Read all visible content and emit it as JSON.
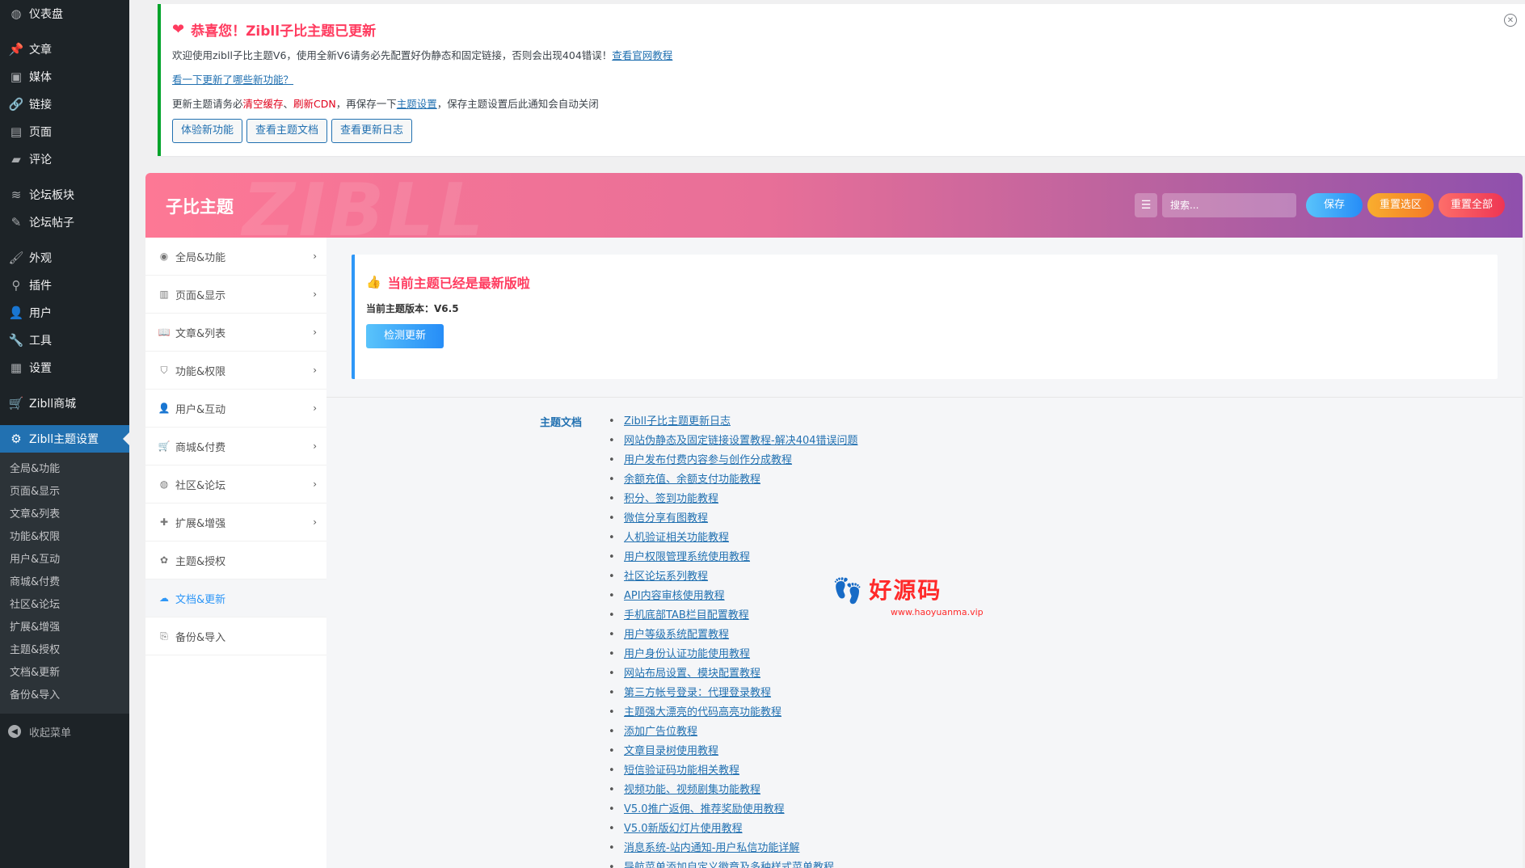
{
  "adminmenu": {
    "groups": [
      [
        {
          "label": "仪表盘",
          "icon": "dashboard-icon"
        }
      ],
      [
        {
          "label": "文章",
          "icon": "pin-icon"
        },
        {
          "label": "媒体",
          "icon": "media-icon"
        },
        {
          "label": "链接",
          "icon": "link-icon"
        },
        {
          "label": "页面",
          "icon": "page-icon"
        },
        {
          "label": "评论",
          "icon": "comment-icon"
        }
      ],
      [
        {
          "label": "论坛板块",
          "icon": "forum-icon"
        },
        {
          "label": "论坛帖子",
          "icon": "forum-post-icon"
        }
      ],
      [
        {
          "label": "外观",
          "icon": "brush-icon"
        },
        {
          "label": "插件",
          "icon": "plugin-icon"
        },
        {
          "label": "用户",
          "icon": "user-icon"
        },
        {
          "label": "工具",
          "icon": "wrench-icon"
        },
        {
          "label": "设置",
          "icon": "settings-icon"
        }
      ],
      [
        {
          "label": "Zibll商城",
          "icon": "cart-icon"
        }
      ]
    ],
    "active": {
      "label": "Zibll主题设置",
      "icon": "gear-icon"
    },
    "submenu": [
      "全局&功能",
      "页面&显示",
      "文章&列表",
      "功能&权限",
      "用户&互动",
      "商城&付费",
      "社区&论坛",
      "扩展&增强",
      "主题&授权",
      "文档&更新",
      "备份&导入"
    ],
    "collapse": "收起菜单"
  },
  "notice": {
    "title": "恭喜您！Zibll子比主题已更新",
    "line1_text": "欢迎使用zibll子比主题V6，使用全新V6请务必先配置好伪静态和固定链接，否则会出现404错误！",
    "line1_link": "查看官网教程",
    "line2_link": "看一下更新了哪些新功能？",
    "line3_a": "更新主题请务必",
    "line3_b": "清空缓存",
    "line3_c": "、",
    "line3_d": "刷新CDN",
    "line3_e": "，再保存一下",
    "line3_f": "主题设置",
    "line3_g": "，保存主题设置后此通知会自动关闭",
    "buttons": [
      "体验新功能",
      "查看主题文档",
      "查看更新日志"
    ]
  },
  "panel": {
    "title": "子比主题",
    "watermark": "ZIBLL",
    "search_placeholder": "搜索...",
    "save": "保存",
    "reset_section": "重置选区",
    "reset_all": "重置全部",
    "nav": [
      {
        "label": "全局&功能",
        "icon": "circle-dot-icon",
        "chevron": true
      },
      {
        "label": "页面&显示",
        "icon": "calendar-icon",
        "chevron": true
      },
      {
        "label": "文章&列表",
        "icon": "book-icon",
        "chevron": true
      },
      {
        "label": "功能&权限",
        "icon": "shield-icon",
        "chevron": true
      },
      {
        "label": "用户&互动",
        "icon": "user-icon",
        "chevron": true
      },
      {
        "label": "商城&付费",
        "icon": "cart-icon",
        "chevron": true
      },
      {
        "label": "社区&论坛",
        "icon": "compass-icon",
        "chevron": true
      },
      {
        "label": "扩展&增强",
        "icon": "puzzle-icon",
        "chevron": true
      },
      {
        "label": "主题&授权",
        "icon": "theme-icon",
        "chevron": false
      },
      {
        "label": "文档&更新",
        "icon": "cloud-icon",
        "chevron": false,
        "active": true
      },
      {
        "label": "备份&导入",
        "icon": "backup-icon",
        "chevron": false
      }
    ],
    "card": {
      "title": "当前主题已经是最新版啦",
      "version": "当前主题版本：V6.5",
      "check_button": "检测更新"
    },
    "docs_label": "主题文档",
    "docs": [
      "Zibll子比主题更新日志",
      "网站伪静态及固定链接设置教程-解决404错误问题",
      "用户发布付费内容参与创作分成教程",
      "余额充值、余额支付功能教程",
      "积分、签到功能教程",
      "微信分享有图教程",
      "人机验证相关功能教程",
      "用户权限管理系统使用教程",
      "社区论坛系列教程",
      "API内容审核使用教程",
      "手机底部TAB栏目配置教程",
      "用户等级系统配置教程",
      "用户身份认证功能使用教程",
      "网站布局设置、模块配置教程",
      "第三方帐号登录：代理登录教程",
      "主题强大漂亮的代码高亮功能教程",
      "添加广告位教程",
      "文章目录树使用教程",
      "短信验证码功能相关教程",
      "视频功能、视频剧集功能教程",
      "V5.0推广返佣、推荐奖励使用教程",
      "V5.0新版幻灯片使用教程",
      "消息系统-站内通知-用户私信功能详解",
      "导航菜单添加自定义徽章及多种样式菜单教程"
    ]
  },
  "watermark": {
    "text": "好源码",
    "sub": "www.haoyuanma.vip"
  }
}
